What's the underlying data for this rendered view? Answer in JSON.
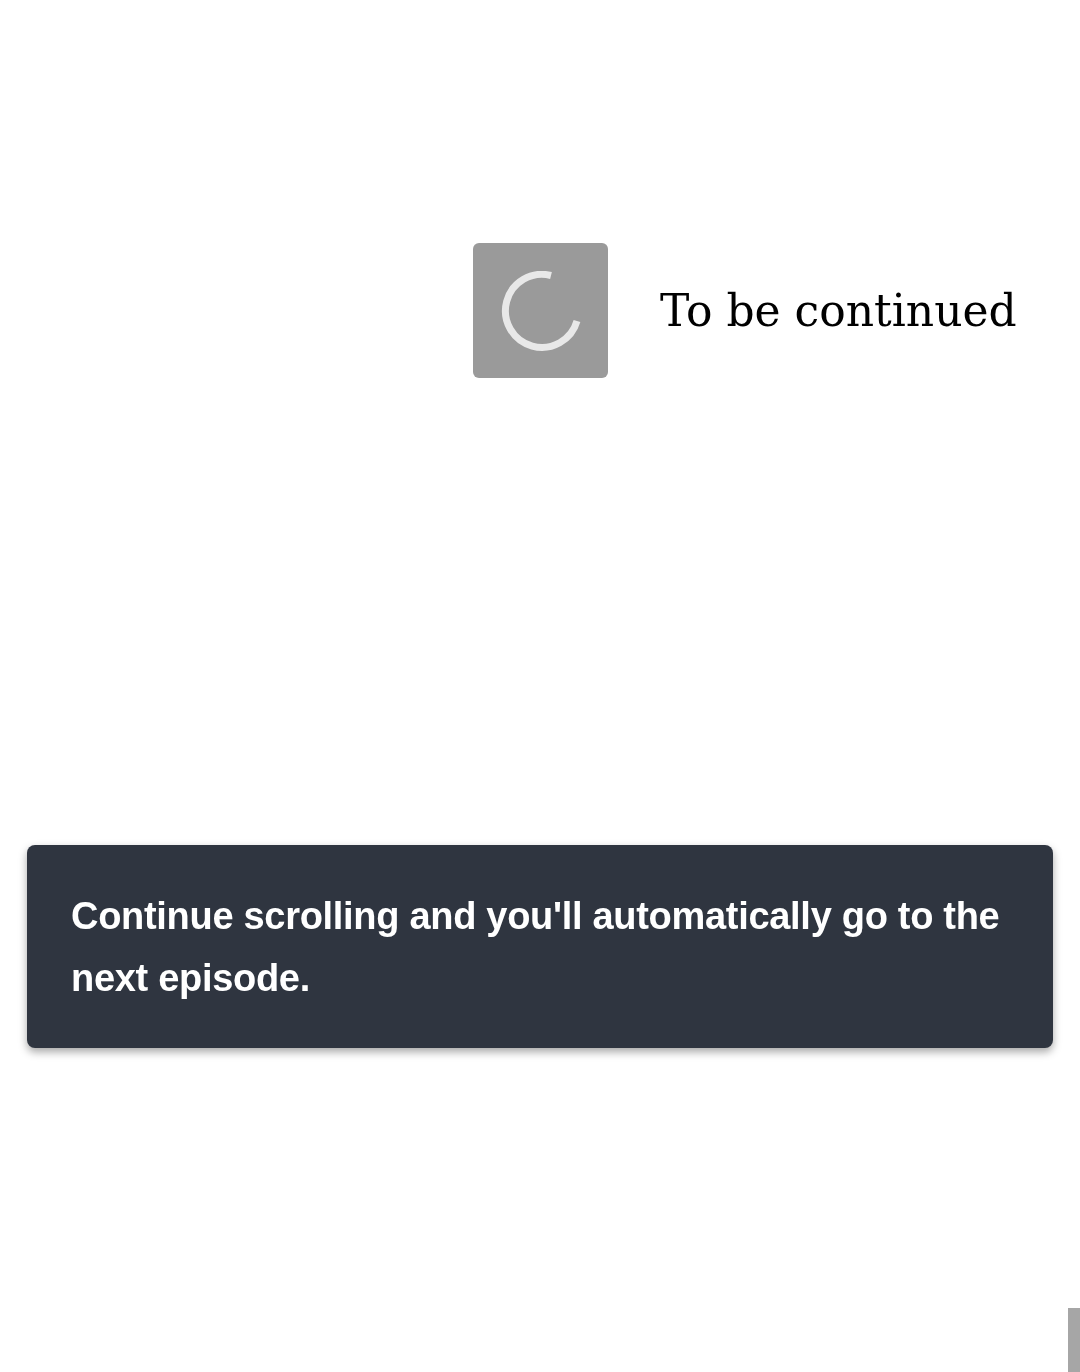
{
  "episode_end": {
    "loading": true,
    "title": "To be continued"
  },
  "toast": {
    "message": "Continue scrolling and you'll automatically go to the next episode."
  }
}
